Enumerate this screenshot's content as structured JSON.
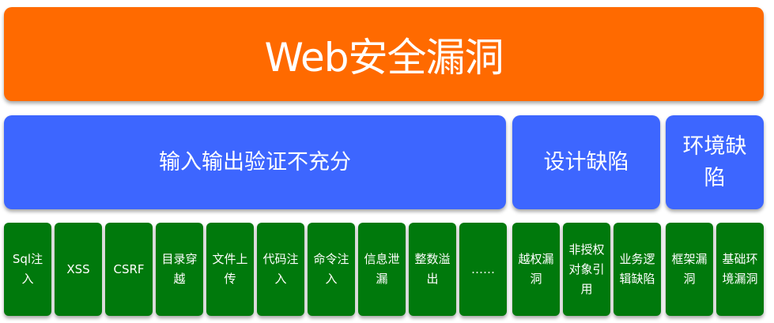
{
  "title": "Web安全漏洞",
  "categories": [
    {
      "label": "输入输出验证不充分"
    },
    {
      "label": "设计缺陷"
    },
    {
      "label": "环境缺陷"
    }
  ],
  "leaves": [
    {
      "label": "Sql注入",
      "category": "输入输出验证不充分"
    },
    {
      "label": "XSS",
      "category": "输入输出验证不充分"
    },
    {
      "label": "CSRF",
      "category": "输入输出验证不充分"
    },
    {
      "label": "目录穿越",
      "category": "输入输出验证不充分"
    },
    {
      "label": "文件上传",
      "category": "输入输出验证不充分"
    },
    {
      "label": "代码注入",
      "category": "输入输出验证不充分"
    },
    {
      "label": "命令注入",
      "category": "输入输出验证不充分"
    },
    {
      "label": "信息泄漏",
      "category": "输入输出验证不充分"
    },
    {
      "label": "整数溢出",
      "category": "输入输出验证不充分"
    },
    {
      "label": "……",
      "category": "输入输出验证不充分"
    },
    {
      "label": "越权漏洞",
      "category": "设计缺陷"
    },
    {
      "label": "非授权对象引用",
      "category": "设计缺陷"
    },
    {
      "label": "业务逻辑缺陷",
      "category": "设计缺陷"
    },
    {
      "label": "框架漏洞",
      "category": "环境缺陷"
    },
    {
      "label": "基础环境漏洞",
      "category": "环境缺陷"
    }
  ],
  "colors": {
    "title": "#ff6a00",
    "category": "#3d66ff",
    "leaf": "#00790c",
    "text": "#ffffff"
  }
}
